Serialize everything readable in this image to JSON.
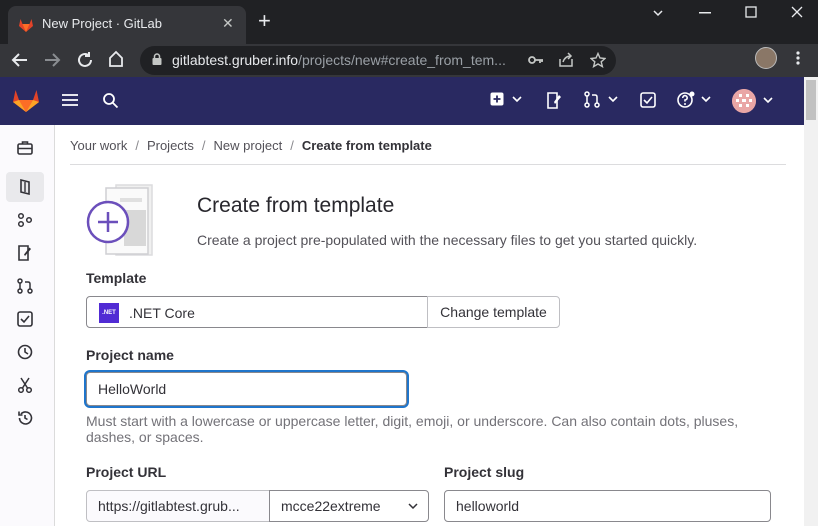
{
  "browser": {
    "tab_title": "New Project · GitLab",
    "close_tab": "✕",
    "new_tab": "+",
    "url_host": "gitlabtest.gruber.info",
    "url_path": "/projects/new#create_from_tem..."
  },
  "sidebar": {
    "items": [
      {
        "icon": "briefcase-icon"
      },
      {
        "icon": "project-icon",
        "active": true
      },
      {
        "icon": "group-icon"
      },
      {
        "icon": "issues-icon"
      },
      {
        "icon": "merge-request-icon"
      },
      {
        "icon": "todo-icon"
      },
      {
        "icon": "clock-icon"
      },
      {
        "icon": "snippet-icon"
      },
      {
        "icon": "history-icon"
      }
    ]
  },
  "breadcrumb": {
    "items": [
      "Your work",
      "Projects",
      "New project",
      "Create from template"
    ],
    "separator": "/"
  },
  "page": {
    "title": "Create from template",
    "description": "Create a project pre-populated with the necessary files to get you started quickly."
  },
  "form": {
    "template_label": "Template",
    "template_badge": ".NET",
    "template_name": ".NET Core",
    "change_template_label": "Change template",
    "project_name_label": "Project name",
    "project_name_value": "HelloWorld",
    "project_name_help": "Must start with a lowercase or uppercase letter, digit, emoji, or underscore. Can also contain dots, pluses, dashes, or spaces.",
    "project_url_label": "Project URL",
    "project_url_prefix": "https://gitlabtest.grub...",
    "namespace_value": "mcce22extreme",
    "project_slug_label": "Project slug",
    "project_slug_value": "helloworld"
  },
  "colors": {
    "header_bg": "#292961",
    "accent": "#1f75cb",
    "illustration": "#6b4fbb"
  }
}
